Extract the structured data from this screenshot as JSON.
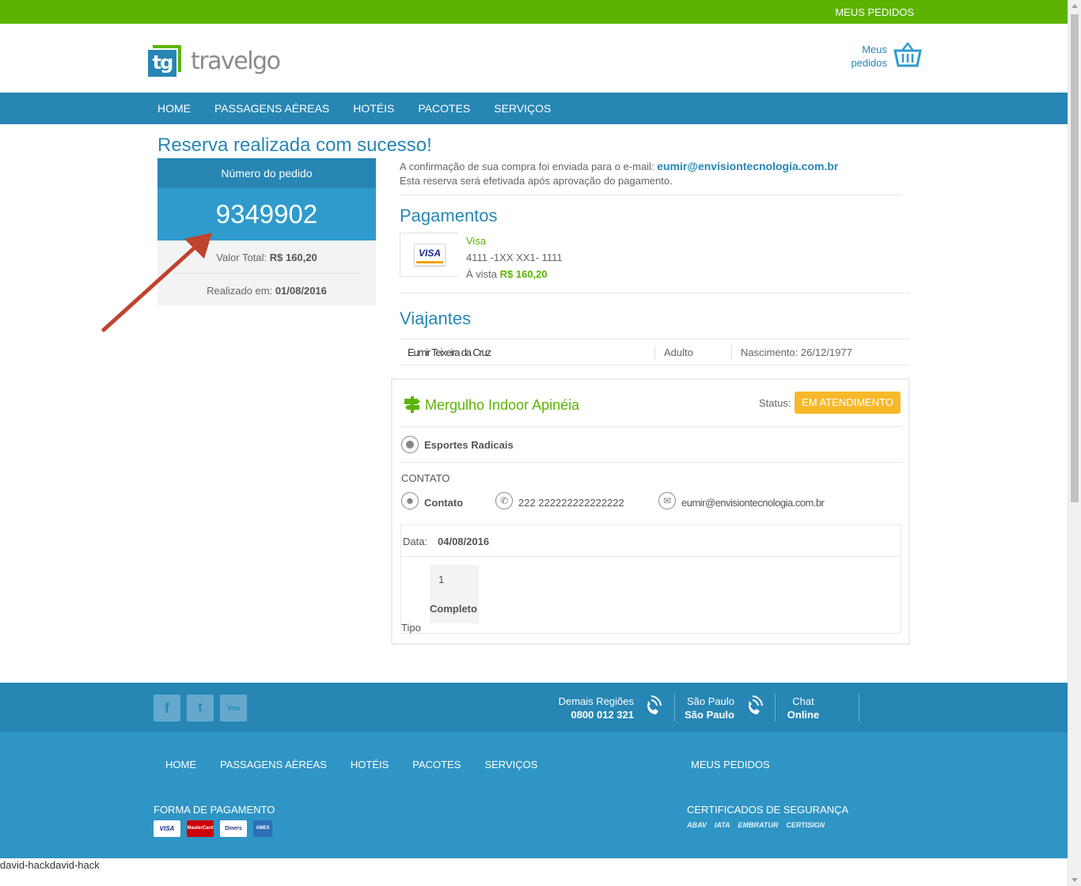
{
  "topbar": {
    "link": "MEUS PEDIDOS"
  },
  "header": {
    "logo_mark": "tg",
    "logo_text": "travelgo",
    "cart_line1": "Meus",
    "cart_line2": "pedidos"
  },
  "nav": {
    "items": [
      "HOME",
      "PASSAGENS AÉREAS",
      "HOTÉIS",
      "PACOTES",
      "SERVIÇOS"
    ]
  },
  "page": {
    "title": "Reserva realizada com sucesso!"
  },
  "order": {
    "label": "Número do pedido",
    "number": "9349902",
    "total_label": "Valor Total:",
    "total_value": "R$ 160,20",
    "date_label": "Realizado em:",
    "date_value": "01/08/2016"
  },
  "confirmation": {
    "text": "A confirmação de sua compra foi enviada para o e-mail:",
    "email": "eumir@envisiontecnologia.com.br",
    "note": "Esta reserva será efetivada após aprovação do pagamento."
  },
  "payments": {
    "title": "Pagamentos",
    "card_logo": "VISA",
    "brand": "Visa",
    "card_number": "4111 -1XX XX1- 1111",
    "mode": "À vista",
    "amount": "R$ 160,20"
  },
  "travelers": {
    "title": "Viajantes",
    "name": "Eumir Teixeira da Cruz",
    "type": "Adulto",
    "birth": "Nascimento: 26/12/1977"
  },
  "service": {
    "title": "Mergulho Indoor Apinéia",
    "status_label": "Status:",
    "status": "EM ATENDIMENTO",
    "category": "Esportes Radicais",
    "contact_heading": "CONTATO",
    "contact_name": "Contato",
    "contact_phone": "222 222222222222222",
    "contact_email": "eumir@envisiontecnologia.com.br",
    "date_label": "Data:",
    "date_value": "04/08/2016",
    "tipo_qty": "1",
    "tipo_name": "Completo",
    "tipo_label": "Tipo"
  },
  "footer": {
    "social": [
      "f",
      "t",
      "You"
    ],
    "regions_label": "Demais Regiões",
    "regions_phone": "0800 012 321",
    "sp_label": "São Paulo",
    "sp_phone": "São Paulo",
    "chat_label": "Chat",
    "chat_status": "Online",
    "nav": [
      "HOME",
      "PASSAGENS AÉREAS",
      "HOTÉIS",
      "PACOTES",
      "SERVIÇOS"
    ],
    "nav_right": "MEUS PEDIDOS",
    "payment_heading": "FORMA DE PAGAMENTO",
    "cards": [
      "VISA",
      "MasterCard",
      "Diners",
      "AMEX"
    ],
    "cert_heading": "CERTIFICADOS DE SEGURANÇA",
    "certs": [
      "ABAV",
      "IATA",
      "EMBRATUR",
      "CERTISIGN"
    ]
  },
  "caption": "david-hackdavid-hack",
  "colors": {
    "green": "#5cb400",
    "blue": "#2786b4",
    "orange": "#f7b92a",
    "arrow": "#c0432e"
  }
}
